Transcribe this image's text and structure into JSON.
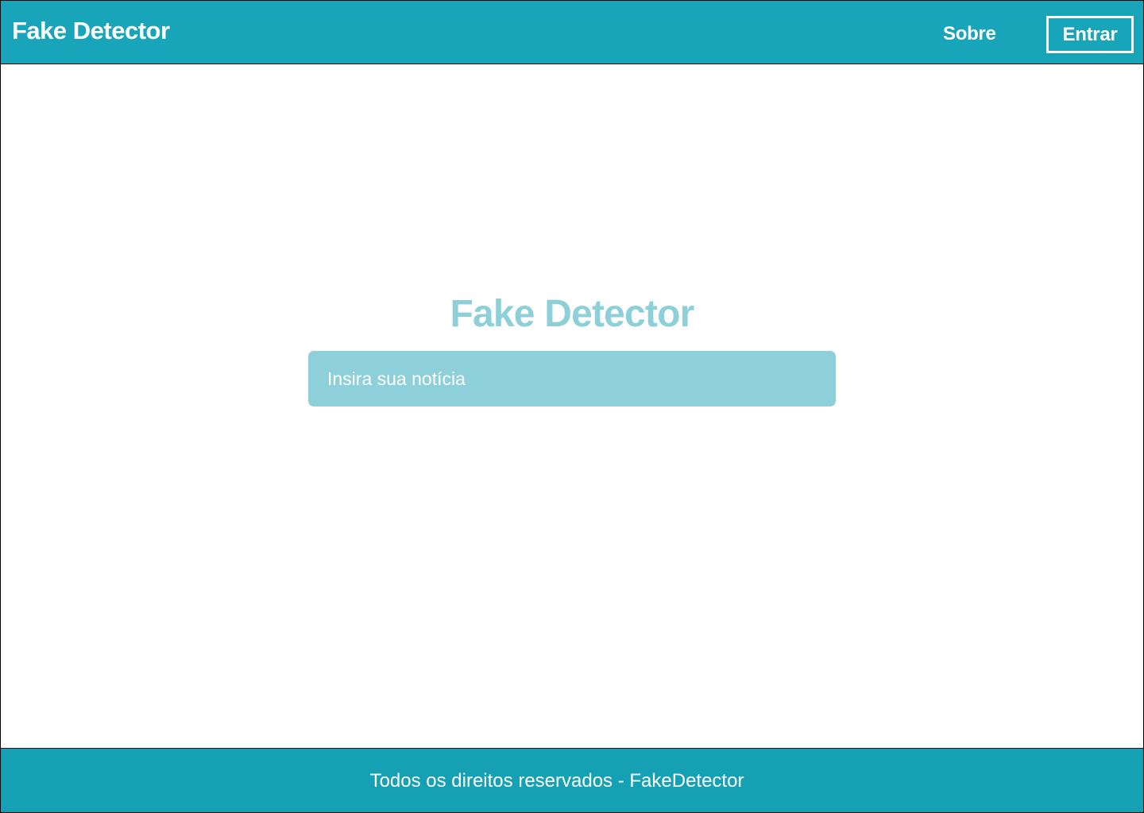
{
  "header": {
    "brand": "Fake Detector",
    "nav_about": "Sobre",
    "login_label": "Entrar"
  },
  "main": {
    "title": "Fake Detector",
    "search_placeholder": "Insira sua notícia"
  },
  "footer": {
    "text": "Todos os direitos reservados - FakeDetector"
  },
  "colors": {
    "header_bg": "#18a4b9",
    "accent_light": "#8dd0da",
    "footer_bg": "#16a0b4",
    "text_on_accent": "#ffffff"
  }
}
